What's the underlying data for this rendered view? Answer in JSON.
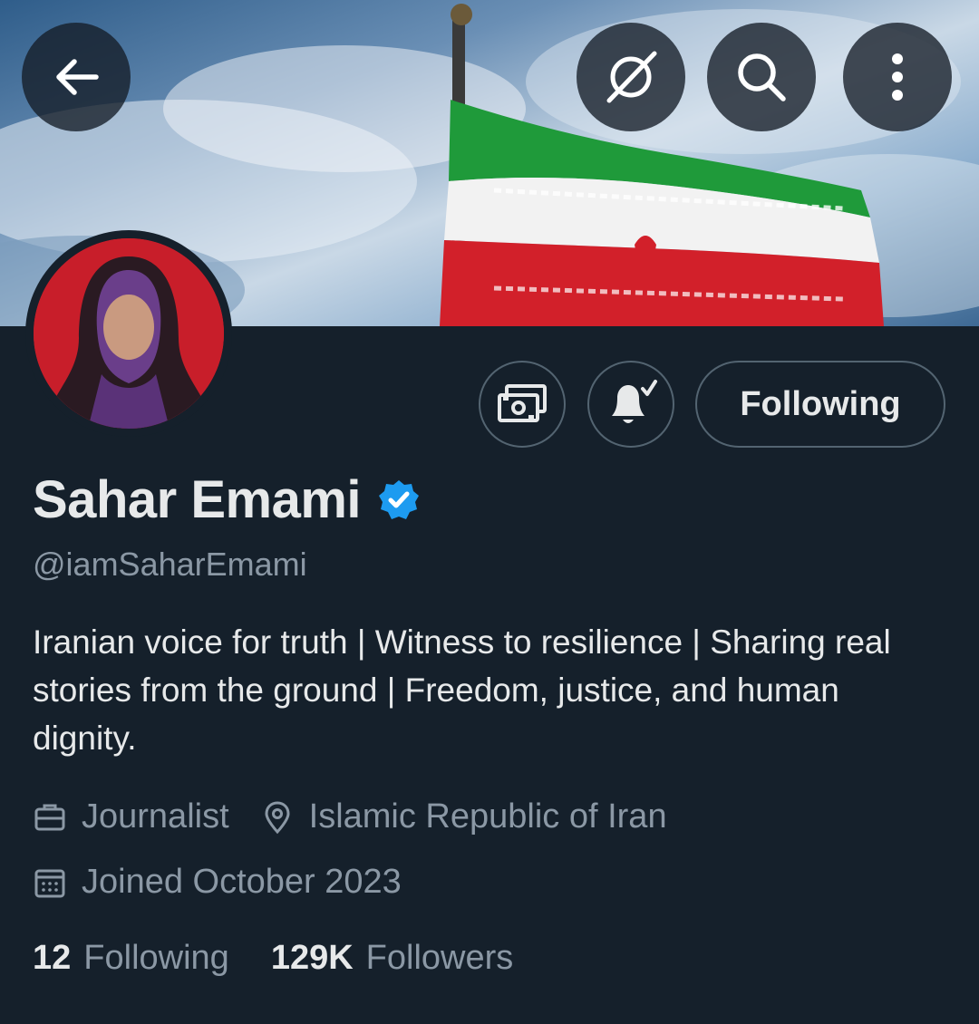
{
  "header": {
    "back_icon": "arrow-left-icon",
    "grok_icon": "grok-icon",
    "search_icon": "search-icon",
    "more_icon": "more-vertical-icon"
  },
  "profile": {
    "name": "Sahar Emami",
    "handle": "@iamSaharEmami",
    "verified": true,
    "bio": "Iranian voice for truth | Witness to resilience | Sharing real stories from the ground | Freedom, justice, and human dignity.",
    "profession": "Journalist",
    "location": "Islamic Republic of Iran",
    "joined": "Joined October 2023"
  },
  "actions": {
    "subscribe_icon": "money-icon",
    "notify_icon": "bell-check-icon",
    "follow_label": "Following"
  },
  "stats": {
    "following_count": "12",
    "following_label": "Following",
    "followers_count": "129K",
    "followers_label": "Followers"
  },
  "colors": {
    "background": "#15202b",
    "text_primary": "#e7e9ea",
    "text_secondary": "#8b98a5",
    "border": "#536471",
    "verified_blue": "#1d9bf0"
  }
}
